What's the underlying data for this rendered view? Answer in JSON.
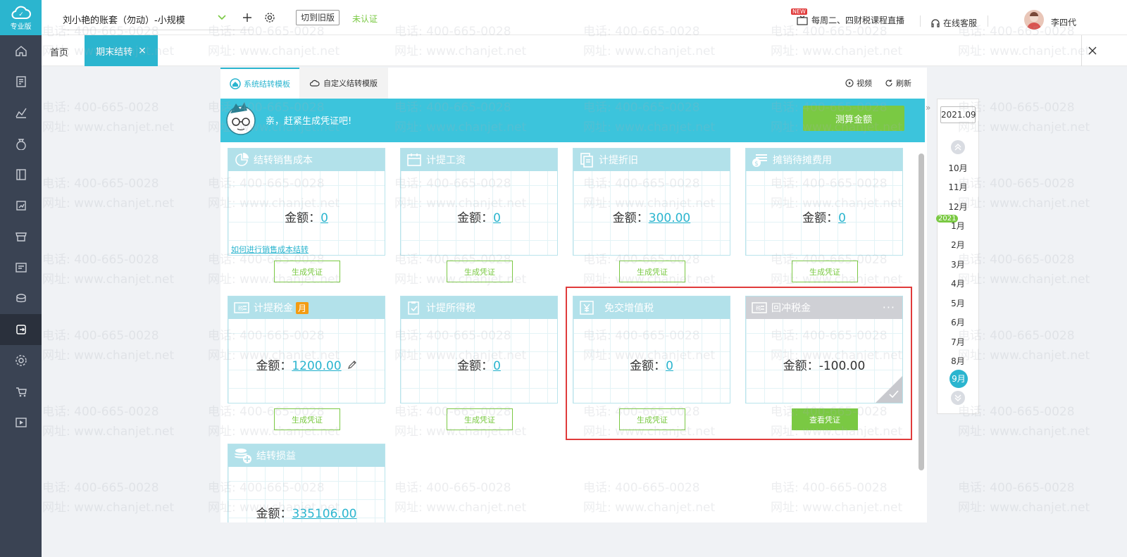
{
  "sidebar": {
    "logo_text": "专业版",
    "items": [
      "home-icon",
      "voucher-icon",
      "chart-icon",
      "money-bag-icon",
      "ledger-icon",
      "report-icon",
      "shop-icon",
      "invoice-icon",
      "assets-icon",
      "period-close-icon",
      "settings-icon",
      "wagon-icon",
      "video-icon"
    ]
  },
  "header": {
    "account": "刘小艳的账套（勿动）-小规模",
    "old_version": "切到旧版",
    "certification": "未认证",
    "new_badge": "NEW",
    "live_course": "每周二、四财税课程直播",
    "service": "在线客服",
    "user": "李四代"
  },
  "tabs": {
    "home": "首页",
    "active": "期末结转",
    "close": "×"
  },
  "subtabs": {
    "system": "系统结转模板",
    "custom": "自定义结转模版",
    "video": "视频",
    "refresh": "刷新"
  },
  "banner": {
    "text": "亲，赶紧生成凭证吧!",
    "calc_button": "测算金额"
  },
  "cards": [
    {
      "title": "结转销售成本",
      "label": "金额：",
      "amount": "0",
      "link": "如何进行销售成本结转",
      "button": "生成凭证"
    },
    {
      "title": "计提工资",
      "label": "金额：",
      "amount": "0",
      "button": "生成凭证"
    },
    {
      "title": "计提折旧",
      "label": "金额：",
      "amount": "300.00",
      "button": "生成凭证"
    },
    {
      "title": "摊销待摊费用",
      "label": "金额：",
      "amount": "0",
      "button": "生成凭证"
    },
    {
      "title": "计提税金",
      "badge": "月",
      "label": "金额：",
      "amount": "1200.00",
      "button": "生成凭证"
    },
    {
      "title": "计提所得税",
      "label": "金额：",
      "amount": "0",
      "button": "生成凭证"
    },
    {
      "title": "免交增值税",
      "label": "金额：",
      "amount": "0",
      "button": "生成凭证"
    },
    {
      "title": "回冲税金",
      "label": "金额：",
      "amount": "-100.00",
      "button": "查看凭证",
      "more": "···"
    },
    {
      "title": "结转损益",
      "label": "金额：",
      "amount": "335106.00"
    }
  ],
  "dates": {
    "collapse": "»",
    "year_select": "2021.09",
    "year_badge": "2021",
    "months": [
      "10月",
      "11月",
      "12月",
      "1月",
      "2月",
      "3月",
      "4月",
      "5月",
      "6月",
      "7月",
      "8月",
      "9月"
    ],
    "active_month": "9月"
  },
  "watermark": {
    "phone": "电话: 400-665-0028",
    "site": "网址: www.chanjet.net"
  },
  "colors": {
    "primary": "#2bb5cf",
    "green": "#7ac943",
    "sidebar": "#3a4353",
    "highlight": "#e03b3b"
  }
}
